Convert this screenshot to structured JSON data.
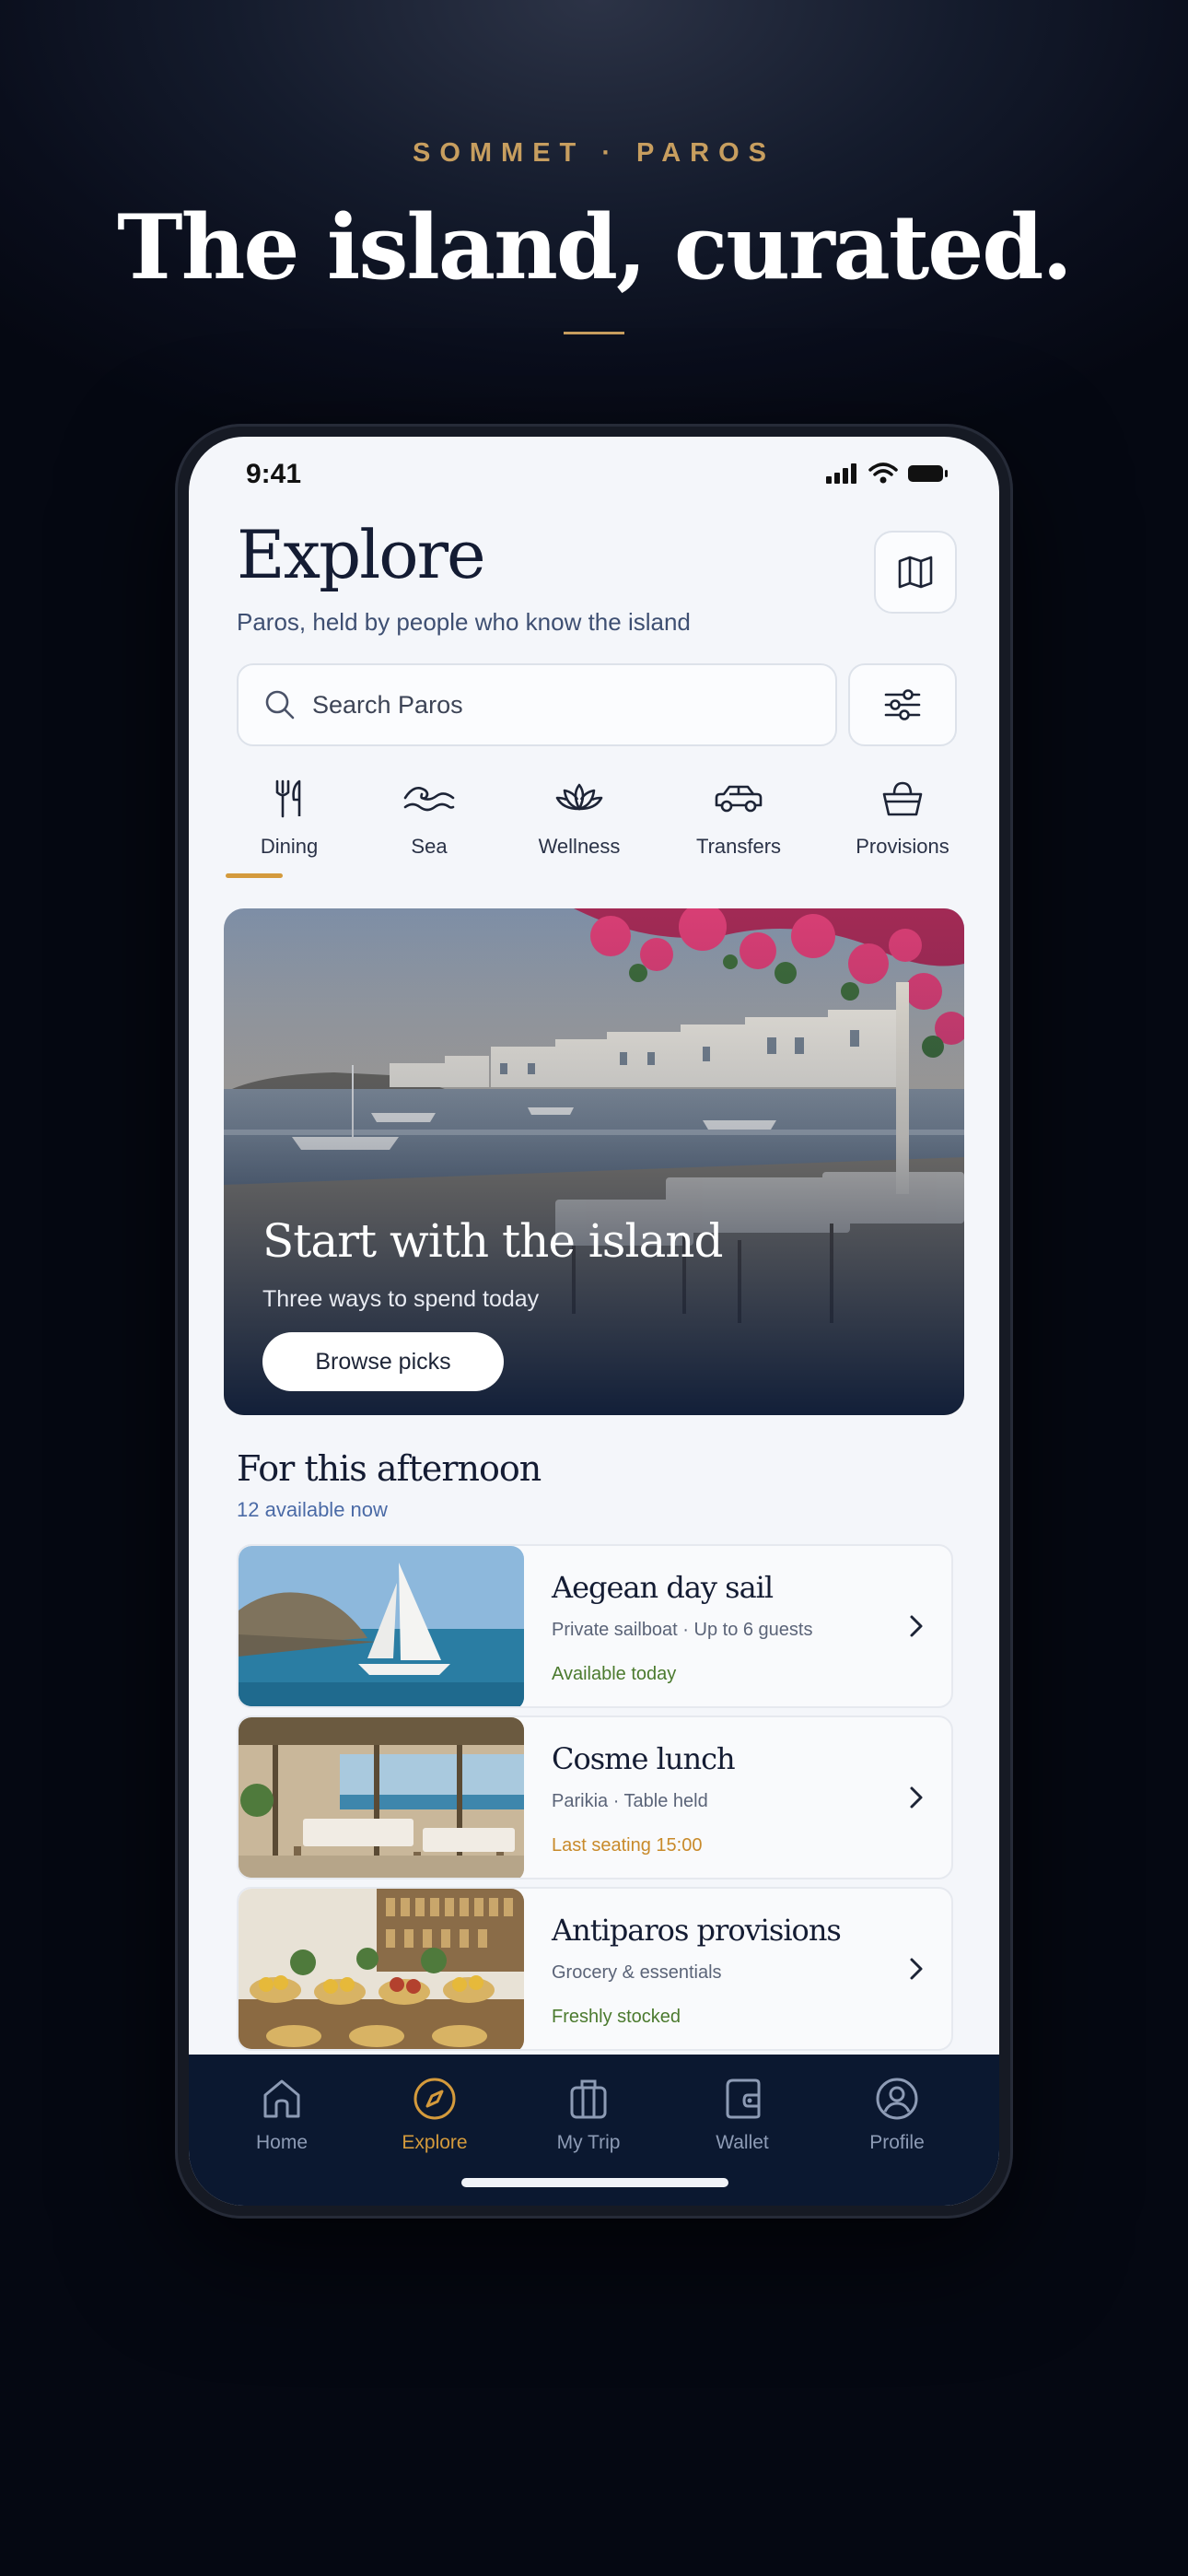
{
  "promo": {
    "eyebrow": "SOMMET · PAROS",
    "headline": "The island, curated."
  },
  "status_bar": {
    "time": "9:41"
  },
  "header": {
    "title": "Explore",
    "subtitle": "Paros, held by people who know the island"
  },
  "search": {
    "placeholder": "Search Paros"
  },
  "categories": [
    {
      "label": "Dining",
      "icon": "fork-knife-icon",
      "selected": true
    },
    {
      "label": "Sea",
      "icon": "waves-icon"
    },
    {
      "label": "Wellness",
      "icon": "lotus-icon"
    },
    {
      "label": "Transfers",
      "icon": "car-icon"
    },
    {
      "label": "Provisions",
      "icon": "basket-icon"
    }
  ],
  "hero": {
    "title": "Start with the island",
    "subtitle": "Three ways to spend today",
    "button": "Browse picks"
  },
  "section": {
    "title": "For this afternoon",
    "count": "12 available now"
  },
  "listings": [
    {
      "title": "Aegean day sail",
      "meta": "Private sailboat · Up to 6 guests",
      "status": "Available today",
      "status_color": "#4b7a2e"
    },
    {
      "title": "Cosme lunch",
      "meta": "Parikia · Table held",
      "status": "Last seating 15:00",
      "status_color": "#c88a2a"
    },
    {
      "title": "Antiparos provisions",
      "meta": "Grocery & essentials",
      "status": "Freshly stocked",
      "status_color": "#4b7a2e"
    }
  ],
  "tabs": [
    {
      "label": "Home",
      "icon": "home-icon"
    },
    {
      "label": "Explore",
      "icon": "compass-icon",
      "active": true
    },
    {
      "label": "My Trip",
      "icon": "suitcase-icon"
    },
    {
      "label": "Wallet",
      "icon": "wallet-icon"
    },
    {
      "label": "Profile",
      "icon": "profile-icon"
    }
  ],
  "colors": {
    "accent": "#d49a3c",
    "navy": "#0b1830",
    "gold_eyebrow": "#c79e5f"
  }
}
